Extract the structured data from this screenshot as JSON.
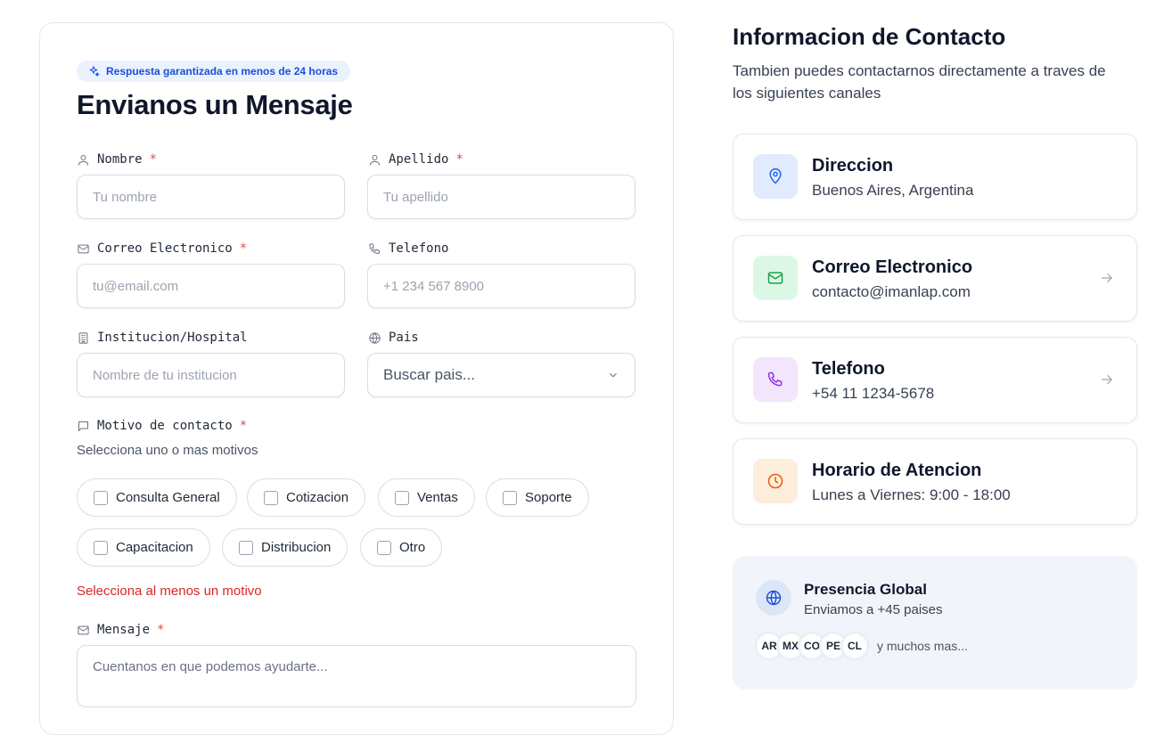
{
  "form": {
    "badge": "Respuesta garantizada en menos de 24 horas",
    "title": "Envianos un Mensaje",
    "fields": {
      "nombre": {
        "label": "Nombre",
        "required": "*",
        "placeholder": "Tu nombre"
      },
      "apellido": {
        "label": "Apellido",
        "required": "*",
        "placeholder": "Tu apellido"
      },
      "correo": {
        "label": "Correo Electronico",
        "required": "*",
        "placeholder": "tu@email.com"
      },
      "telefono": {
        "label": "Telefono",
        "placeholder": "+1 234 567 8900"
      },
      "institucion": {
        "label": "Institucion/Hospital",
        "placeholder": "Nombre de tu institucion"
      },
      "pais": {
        "label": "Pais",
        "value": "Buscar pais..."
      }
    },
    "motivo": {
      "label": "Motivo de contacto",
      "required": "*",
      "hint": "Selecciona uno o mas motivos",
      "options": [
        "Consulta General",
        "Cotizacion",
        "Ventas",
        "Soporte",
        "Capacitacion",
        "Distribucion",
        "Otro"
      ],
      "error": "Selecciona al menos un motivo"
    },
    "mensaje": {
      "label": "Mensaje",
      "required": "*",
      "placeholder": "Cuentanos en que podemos ayudarte..."
    }
  },
  "contact": {
    "title": "Informacion de Contacto",
    "description": "Tambien puedes contactarnos directamente a traves de los siguientes canales",
    "cards": [
      {
        "title": "Direccion",
        "value": "Buenos Aires, Argentina",
        "icon": "map-pin-icon",
        "icon_bg": "#e0ebfd",
        "icon_color": "#2563eb"
      },
      {
        "title": "Correo Electronico",
        "value": "contacto@imanlap.com",
        "icon": "mail-icon",
        "icon_bg": "#ddf7e6",
        "icon_color": "#16a34a",
        "arrow": true
      },
      {
        "title": "Telefono",
        "value": "+54 11 1234-5678",
        "icon": "phone-icon",
        "icon_bg": "#f3e5fd",
        "icon_color": "#9333ea",
        "arrow": true
      },
      {
        "title": "Horario de Atencion",
        "value": "Lunes a Viernes: 9:00 - 18:00",
        "icon": "clock-icon",
        "icon_bg": "#fdeedb",
        "icon_color": "#ea580c"
      }
    ],
    "global": {
      "title": "Presencia Global",
      "subtitle": "Enviamos a +45 paises",
      "countries": [
        "AR",
        "MX",
        "CO",
        "PE",
        "CL"
      ],
      "more": "y muchos mas..."
    }
  },
  "colors": {
    "accent": "#1d4ed8",
    "error": "#dc2626",
    "required": "#ef4444"
  }
}
